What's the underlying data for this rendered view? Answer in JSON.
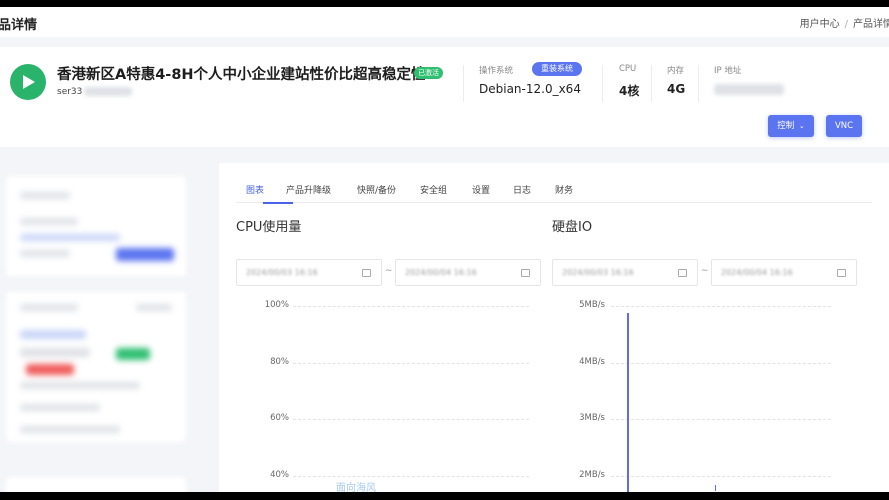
{
  "header": {
    "page_title": "品详情",
    "breadcrumb": [
      "用户中心",
      "产品详情"
    ]
  },
  "product": {
    "name": "香港新区A特惠4-8H个人中小企业建站性价比超高稳定性",
    "status_badge": "已激活",
    "hostname_prefix": "ser33",
    "specs": {
      "os_label": "操作系统",
      "os_value": "Debian-12.0_x64",
      "reinstall_label": "重装系统",
      "cpu_label": "CPU",
      "cpu_value": "4核",
      "memory_label": "内存",
      "memory_value": "4G",
      "ip_label": "IP 地址"
    },
    "actions": {
      "control_label": "控制",
      "vnc_label": "VNC"
    }
  },
  "tabs": [
    "图表",
    "产品升降级",
    "快照/备份",
    "安全组",
    "设置",
    "日志",
    "财务"
  ],
  "active_tab": "图表",
  "charts": {
    "cpu": {
      "title": "CPU使用量",
      "y_ticks": [
        "100%",
        "80%",
        "60%",
        "40%"
      ]
    },
    "disk": {
      "title": "硬盘IO",
      "y_ticks": [
        "5MB/s",
        "4MB/s",
        "3MB/s",
        "2MB/s"
      ],
      "spike_color": "#5b6cf0"
    }
  },
  "watermark": "面向海风",
  "colors": {
    "accent": "#5b74f0",
    "success": "#29b36b"
  }
}
